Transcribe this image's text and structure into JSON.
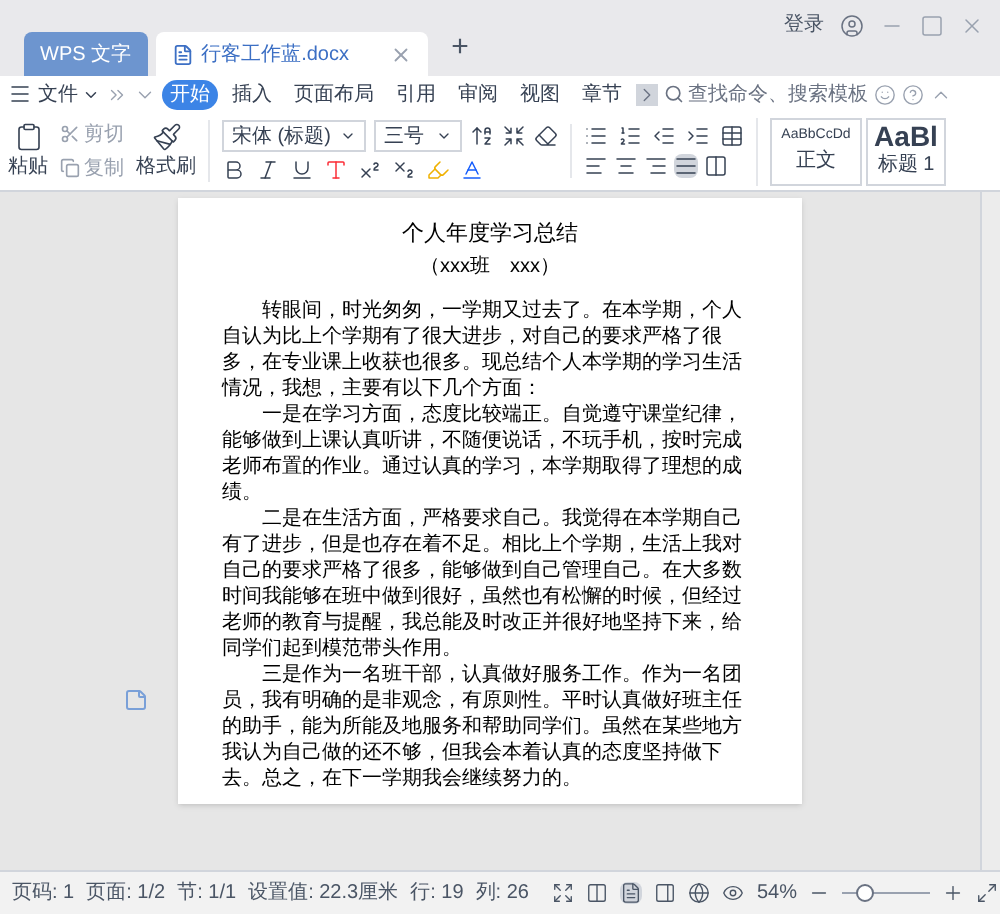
{
  "tabs": [
    {
      "label": "WPS 文字",
      "kind": "app",
      "selected": false
    },
    {
      "label": "行客工作蓝.docx",
      "kind": "doc",
      "selected": true
    }
  ],
  "title_bar": {
    "login": "登录",
    "new_tab": "+"
  },
  "menu": {
    "file": "文件",
    "items": [
      {
        "label": "开始",
        "selected": true
      },
      {
        "label": "插入",
        "selected": false
      },
      {
        "label": "页面布局",
        "selected": false
      },
      {
        "label": "引用",
        "selected": false
      },
      {
        "label": "审阅",
        "selected": false
      },
      {
        "label": "视图",
        "selected": false
      },
      {
        "label": "章节",
        "selected": false
      }
    ],
    "search": {
      "placeholder": "查找命令、搜索模板"
    }
  },
  "ribbon": {
    "paste": "粘贴",
    "cut": {
      "label": "剪切",
      "disabled": true
    },
    "copy": {
      "label": "复制",
      "disabled": true
    },
    "format_painter": "格式刷",
    "font": "宋体 (标题)",
    "size": "三号",
    "alignment": [
      {
        "selected": false
      },
      {
        "selected": false
      },
      {
        "selected": false
      },
      {
        "selected": true
      },
      {
        "selected": false
      }
    ],
    "styles": [
      {
        "preview": "AaBbCcDd",
        "name": "正文",
        "kind": "body"
      },
      {
        "preview": "AaBl",
        "name": "标题 1",
        "kind": "heading"
      }
    ]
  },
  "document": {
    "title": "个人年度学习总结",
    "subtitle": "（xxx班　xxx）",
    "paragraphs": [
      "转眼间，时光匆匆，一学期又过去了。在本学期，个人自认为比上个学期有了很大进步，对自己的要求严格了很多，在专业课上收获也很多。现总结个人本学期的学习生活情况，我想，主要有以下几个方面：",
      "一是在学习方面，态度比较端正。自觉遵守课堂纪律，能够做到上课认真听讲，不随便说话，不玩手机，按时完成老师布置的作业。通过认真的学习，本学期取得了理想的成绩。",
      "二是在生活方面，严格要求自己。我觉得在本学期自己有了进步，但是也存在着不足。相比上个学期，生活上我对自己的要求严格了很多，能够做到自己管理自己。在大多数时间我能够在班中做到很好，虽然也有松懈的时候，但经过老师的教育与提醒，我总能及时改正并很好地坚持下来，给同学们起到模范带头作用。",
      "三是作为一名班干部，认真做好服务工作。作为一名团员，我有明确的是非观念，有原则性。平时认真做好班主任的助手，能为所能及地服务和帮助同学们。虽然在某些地方我认为自己做的还不够，但我会本着认真的态度坚持做下去。总之，在下一学期我会继续努力的。"
    ]
  },
  "status_bar": {
    "fields": [
      "页码: 1",
      "页面: 1/2",
      "节: 1/1",
      "设置值: 22.3厘米",
      "行: 19",
      "列: 26"
    ],
    "views": [
      {
        "selected": false
      },
      {
        "selected": false
      },
      {
        "selected": true
      },
      {
        "selected": false
      },
      {
        "selected": false
      },
      {
        "selected": false
      }
    ],
    "zoom": "54%",
    "zoom_slider": {
      "level": 0.25
    }
  }
}
